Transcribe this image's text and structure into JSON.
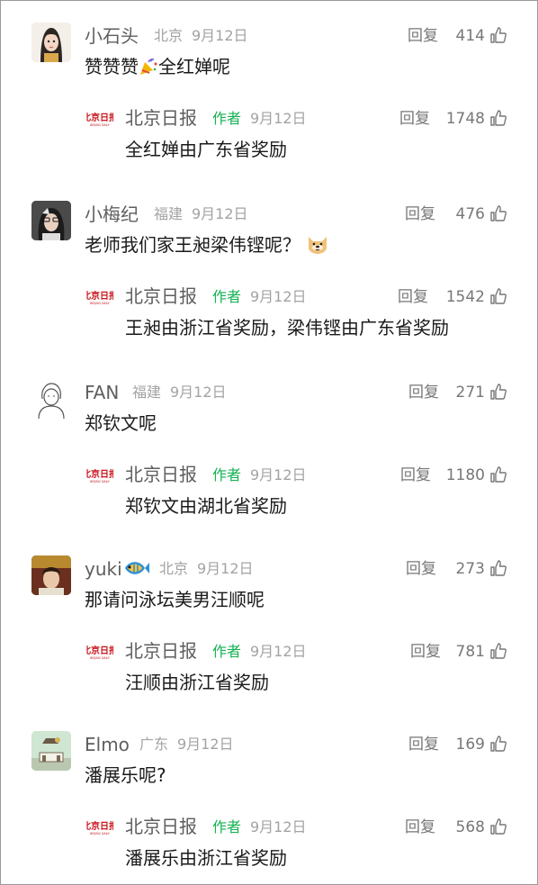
{
  "threads": [
    {
      "user": {
        "name": "小石头",
        "location": "北京",
        "date": "9月12日",
        "reply": "回复",
        "likes": "414",
        "text_before": "赞赞赞",
        "text_after": "全红婵呢"
      },
      "author_reply": {
        "name": "北京日报",
        "badge": "作者",
        "date": "9月12日",
        "reply": "回复",
        "likes": "1748",
        "text": "全红婵由广东省奖励"
      }
    },
    {
      "user": {
        "name": "小梅纪",
        "location": "福建",
        "date": "9月12日",
        "reply": "回复",
        "likes": "476",
        "text": "老师我们家王昶梁伟铿呢？"
      },
      "author_reply": {
        "name": "北京日报",
        "badge": "作者",
        "date": "9月12日",
        "reply": "回复",
        "likes": "1542",
        "text": "王昶由浙江省奖励，梁伟铿由广东省奖励"
      }
    },
    {
      "user": {
        "name": "FAN",
        "location": "福建",
        "date": "9月12日",
        "reply": "回复",
        "likes": "271",
        "text": "郑钦文呢"
      },
      "author_reply": {
        "name": "北京日报",
        "badge": "作者",
        "date": "9月12日",
        "reply": "回复",
        "likes": "1180",
        "text": "郑钦文由湖北省奖励"
      }
    },
    {
      "user": {
        "name": "yuki",
        "location": "北京",
        "date": "9月12日",
        "reply": "回复",
        "likes": "273",
        "text": "那请问泳坛美男汪顺呢"
      },
      "author_reply": {
        "name": "北京日报",
        "badge": "作者",
        "date": "9月12日",
        "reply": "回复",
        "likes": "781",
        "text": "汪顺由浙江省奖励"
      }
    },
    {
      "user": {
        "name": "Elmo",
        "location": "广东",
        "date": "9月12日",
        "reply": "回复",
        "likes": "169",
        "text": "潘展乐呢?"
      },
      "author_reply": {
        "name": "北京日报",
        "badge": "作者",
        "date": "9月12日",
        "reply": "回复",
        "likes": "568",
        "text": "潘展乐由浙江省奖励"
      }
    }
  ],
  "logo_text": {
    "cn": "北京日报",
    "en": "BEIJING DAILY"
  },
  "colors": {
    "author_badge": "#14b252",
    "meta": "#a3a3a3",
    "logo": "#c8161d"
  }
}
